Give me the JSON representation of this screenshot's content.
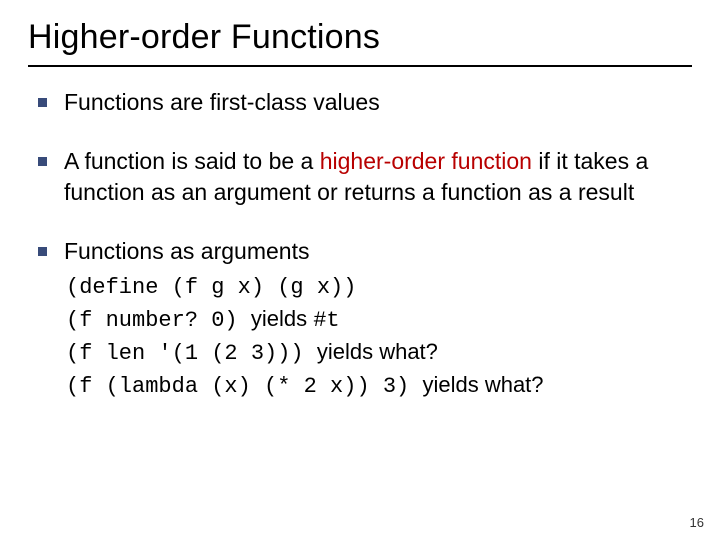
{
  "title": "Higher-order Functions",
  "bullets": {
    "b1": "Functions are first-class values",
    "b2_pre": "A function is said to be a ",
    "b2_term": "higher-order function",
    "b2_post": " if it takes a function as an argument or returns a function as a result",
    "b3": "Functions as arguments"
  },
  "code": {
    "l1": "(define (f g x) (g x))",
    "l2a": "(f number? 0) ",
    "l2b": "yields ",
    "l2c": "#t",
    "l3a": "(f len '(1 (2 3))) ",
    "l3b": "yields what?",
    "l4a": "(f (lambda (x) (* 2  x)) 3) ",
    "l4b": "yields what?"
  },
  "pagenum": "16"
}
